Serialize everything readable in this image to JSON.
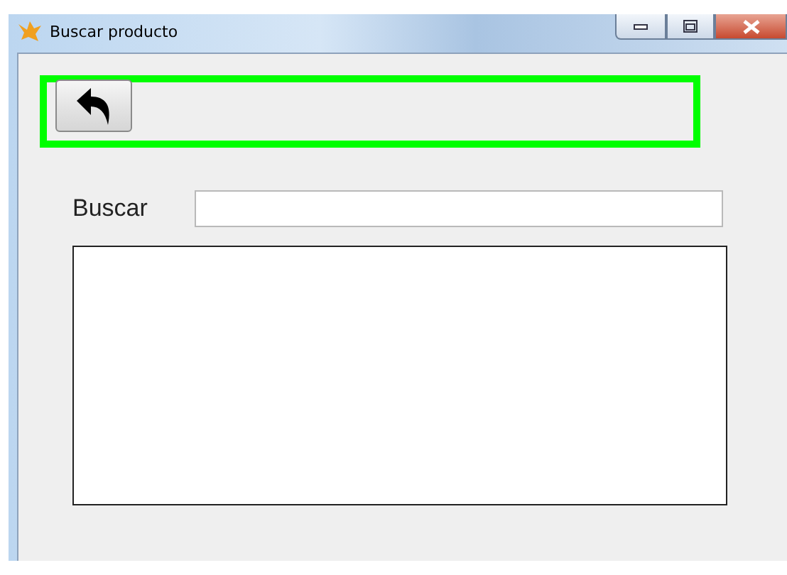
{
  "window": {
    "title": "Buscar producto"
  },
  "search": {
    "label": "Buscar"
  }
}
